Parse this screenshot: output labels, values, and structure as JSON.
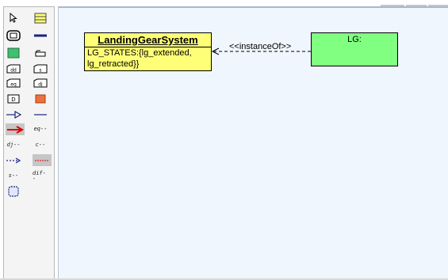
{
  "diagram": {
    "class": {
      "name": "LandingGearSystem",
      "attribute_line1": "LG_STATES:{lg_extended,",
      "attribute_line2": "lg_retracted}}"
    },
    "instance": {
      "name": "LG:"
    },
    "dependency": {
      "stereotype": "<<instanceOf>>"
    }
  },
  "toolbox": {
    "tools": [
      {
        "icon": "select-arrow-icon"
      },
      {
        "icon": "note-icon"
      },
      {
        "icon": "package-icon"
      },
      {
        "icon": "solid-line-icon"
      },
      {
        "icon": "green-box-icon"
      },
      {
        "icon": "small-rect-icon"
      },
      {
        "icon": "diagram-icon-1"
      },
      {
        "icon": "diagram-icon-2"
      },
      {
        "icon": "diagram-icon-3"
      },
      {
        "icon": "diagram-icon-4"
      },
      {
        "icon": "d-box-icon"
      },
      {
        "icon": "orange-box-icon"
      },
      {
        "icon": "generalization-arrow-icon"
      },
      {
        "icon": "association-line-icon"
      },
      {
        "icon": "red-arrow-icon",
        "selected": true
      },
      {
        "icon": "eq-dependency-icon",
        "label": "eq--"
      },
      {
        "icon": "dj-dependency-icon",
        "label": "dj--"
      },
      {
        "icon": "c-dependency-icon",
        "label": "c--"
      },
      {
        "icon": "dashed-arrow-icon"
      },
      {
        "icon": "dotted-line-icon",
        "selected": true
      },
      {
        "icon": "s-dependency-icon",
        "label": "s--"
      },
      {
        "icon": "dif-dependency-icon",
        "label": "dif--"
      },
      {
        "icon": "boundary-icon"
      }
    ]
  },
  "colors": {
    "class_fill": "#ffff77",
    "instance_fill": "#80ff80",
    "canvas_bg": "#eff6fd"
  }
}
